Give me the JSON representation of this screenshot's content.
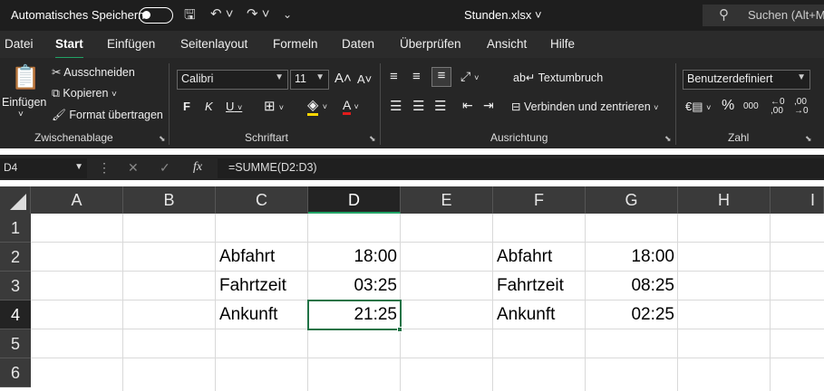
{
  "titlebar": {
    "autosave_label": "Automatisches Speichern",
    "autosave_state": "off",
    "filename": "Stunden.xlsx",
    "search_placeholder": "Suchen (Alt+M)"
  },
  "menu": {
    "tabs": [
      "Datei",
      "Start",
      "Einfügen",
      "Seitenlayout",
      "Formeln",
      "Daten",
      "Überprüfen",
      "Ansicht",
      "Hilfe"
    ],
    "active": "Start"
  },
  "ribbon": {
    "clipboard": {
      "paste": "Einfügen",
      "cut": "Ausschneiden",
      "copy": "Kopieren",
      "format_painter": "Format übertragen",
      "label": "Zwischenablage"
    },
    "font": {
      "name": "Calibri",
      "size": "11",
      "bold": "F",
      "italic": "K",
      "underline": "U",
      "label": "Schriftart"
    },
    "alignment": {
      "wrap": "Textumbruch",
      "merge": "Verbinden und zentrieren",
      "label": "Ausrichtung"
    },
    "number": {
      "format": "Benutzerdefiniert",
      "label": "Zahl"
    }
  },
  "formula_bar": {
    "name_box": "D4",
    "fx": "fx",
    "formula": "=SUMME(D2:D3)"
  },
  "sheet": {
    "columns": [
      "A",
      "B",
      "C",
      "D",
      "E",
      "F",
      "G",
      "H",
      "I"
    ],
    "rows": [
      "1",
      "2",
      "3",
      "4",
      "5",
      "6"
    ],
    "selected_cell": "D4",
    "cells": {
      "C2": "Abfahrt",
      "D2": "18:00",
      "C3": "Fahrtzeit",
      "D3": "03:25",
      "C4": "Ankunft",
      "D4": "21:25",
      "F2": "Abfahrt",
      "G2": "18:00",
      "F3": "Fahrtzeit",
      "G3": "08:25",
      "F4": "Ankunft",
      "G4": "02:25"
    }
  },
  "colors": {
    "accent": "#21a366",
    "selection": "#217346",
    "titlebar": "#1e1e1e",
    "ribbon": "#262626"
  }
}
